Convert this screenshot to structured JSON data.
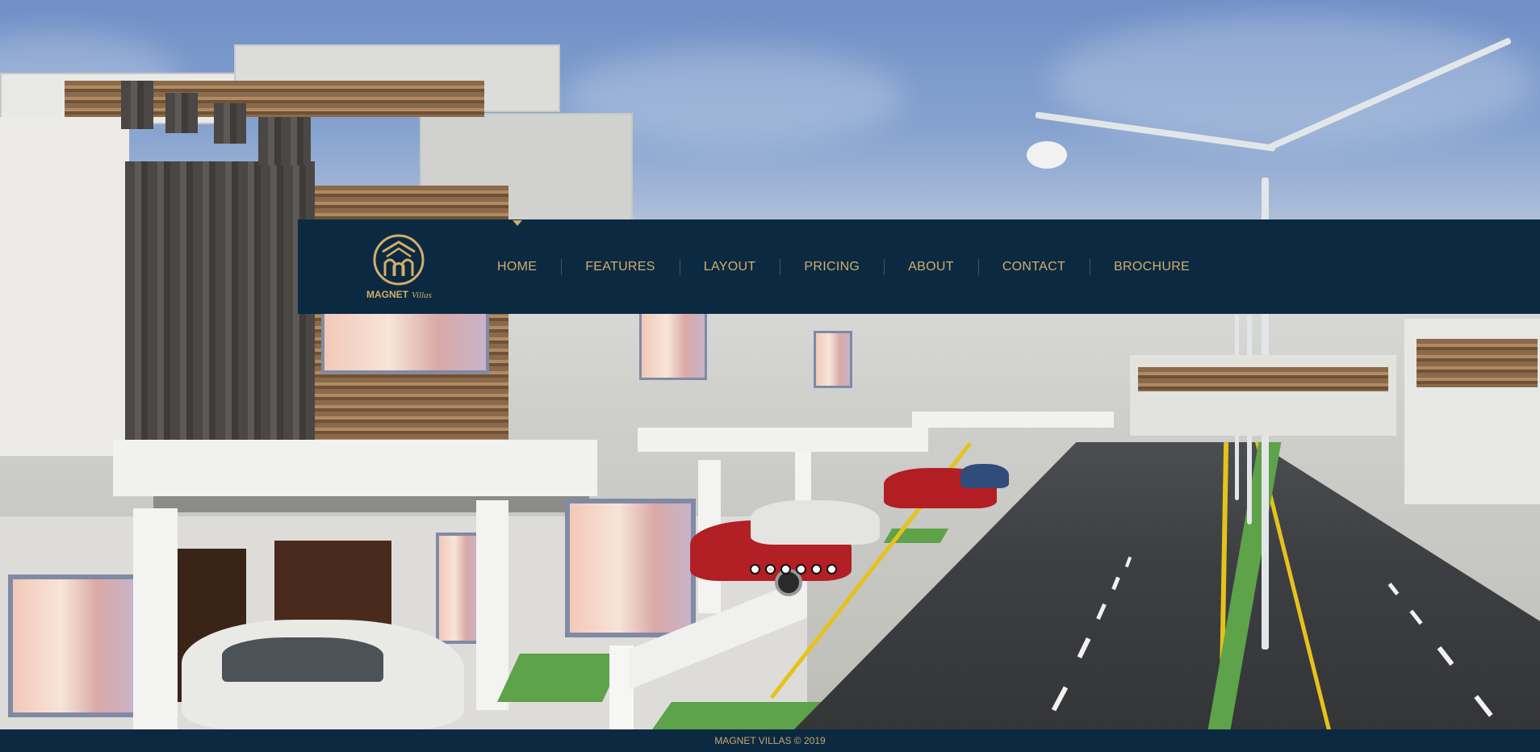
{
  "brand": {
    "logo_word": "MAGNET",
    "logo_script": "Villas",
    "logo_icon": "magnet-villas-emblem-icon",
    "gold": "#d3ad6b",
    "navy": "#0b2a42"
  },
  "nav": {
    "items": [
      {
        "label": "HOME",
        "active": true
      },
      {
        "label": "FEATURES",
        "active": false
      },
      {
        "label": "LAYOUT",
        "active": false
      },
      {
        "label": "PRICING",
        "active": false
      },
      {
        "label": "ABOUT",
        "active": false
      },
      {
        "label": "CONTACT",
        "active": false
      },
      {
        "label": "BROCHURE",
        "active": false
      }
    ]
  },
  "slider": {
    "slide_count": 6,
    "active_index": 1
  },
  "footer": {
    "text": "MAGNET VILLAS © 2019"
  }
}
